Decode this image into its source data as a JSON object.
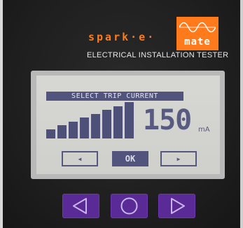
{
  "brand": {
    "wordmark": "spark·e·",
    "mark_text": "mate",
    "subtitle": "ELECTRICAL INSTALLATION TESTER"
  },
  "screen": {
    "title": "SELECT TRIP CURRENT",
    "value": "150",
    "unit": "mA",
    "selected_level": 8,
    "level_count": 8,
    "softkeys": {
      "left": "◂",
      "ok": "OK",
      "right": "▸"
    }
  },
  "hardware_buttons": {
    "left": "left-triangle",
    "center": "circle",
    "right": "right-triangle"
  },
  "colors": {
    "brand_orange": "#ff7a1a",
    "lcd_ink": "#52547e",
    "lcd_background": "#d3d3cf",
    "button_purple": "#5a2a96"
  }
}
